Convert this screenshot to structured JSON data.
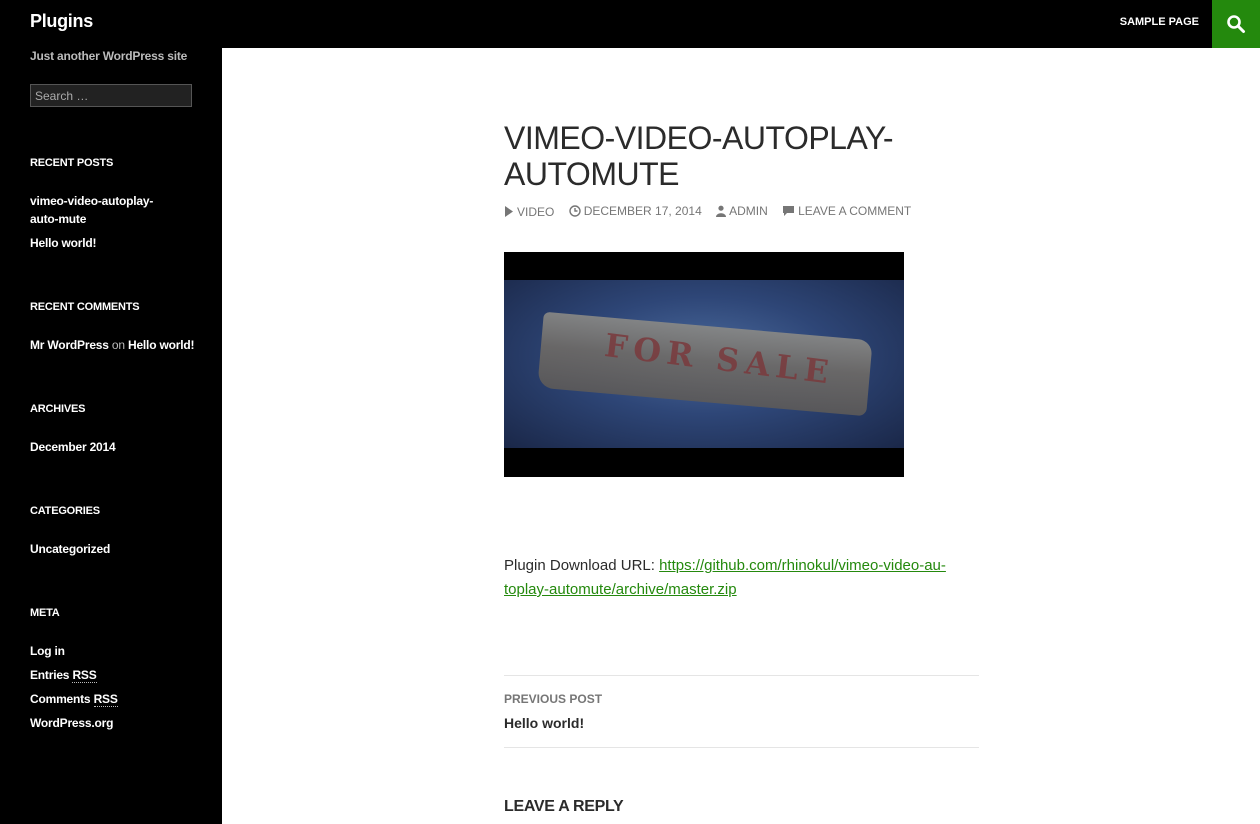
{
  "header": {
    "site_title": "Plugins",
    "nav_item": "SAMPLE PAGE",
    "search_icon": "search-icon",
    "accent_color": "#24890d"
  },
  "sidebar": {
    "tagline": "Just another WordPress site",
    "search_placeholder": "Search …",
    "recent_posts": {
      "title": "RECENT POSTS",
      "items": [
        "vimeo-video-autoplay-auto-mute",
        "Hello world!"
      ]
    },
    "recent_comments": {
      "title": "RECENT COMMENTS",
      "author": "Mr WordPress",
      "on": "on",
      "post": "Hello world!"
    },
    "archives": {
      "title": "ARCHIVES",
      "items": [
        "December 2014"
      ]
    },
    "categories": {
      "title": "CATEGORIES",
      "items": [
        "Uncategorized"
      ]
    },
    "meta": {
      "title": "META",
      "log_in": "Log in",
      "entries_prefix": "Entries",
      "comments_prefix": "Comments",
      "rss": "RSS",
      "wordpress_org": "WordPress.org"
    }
  },
  "post": {
    "title": "VIMEO-VIDEO-AUTOPLAY-AUTOMUTE",
    "meta": {
      "format": "VIDEO",
      "date": "DECEMBER 17, 2014",
      "author": "ADMIN",
      "comments": "LEAVE A COMMENT"
    },
    "video_sign_text": "FOR SALE",
    "plugin_label": "Plugin Download URL:",
    "plugin_url_line1": "https://github.com/rhinokul/vimeo-video-au-",
    "plugin_url_line2": "toplay-automute/archive/master.zip"
  },
  "post_navigation": {
    "label": "PREVIOUS POST",
    "title": "Hello world!"
  },
  "reply": {
    "title": "LEAVE A REPLY"
  }
}
